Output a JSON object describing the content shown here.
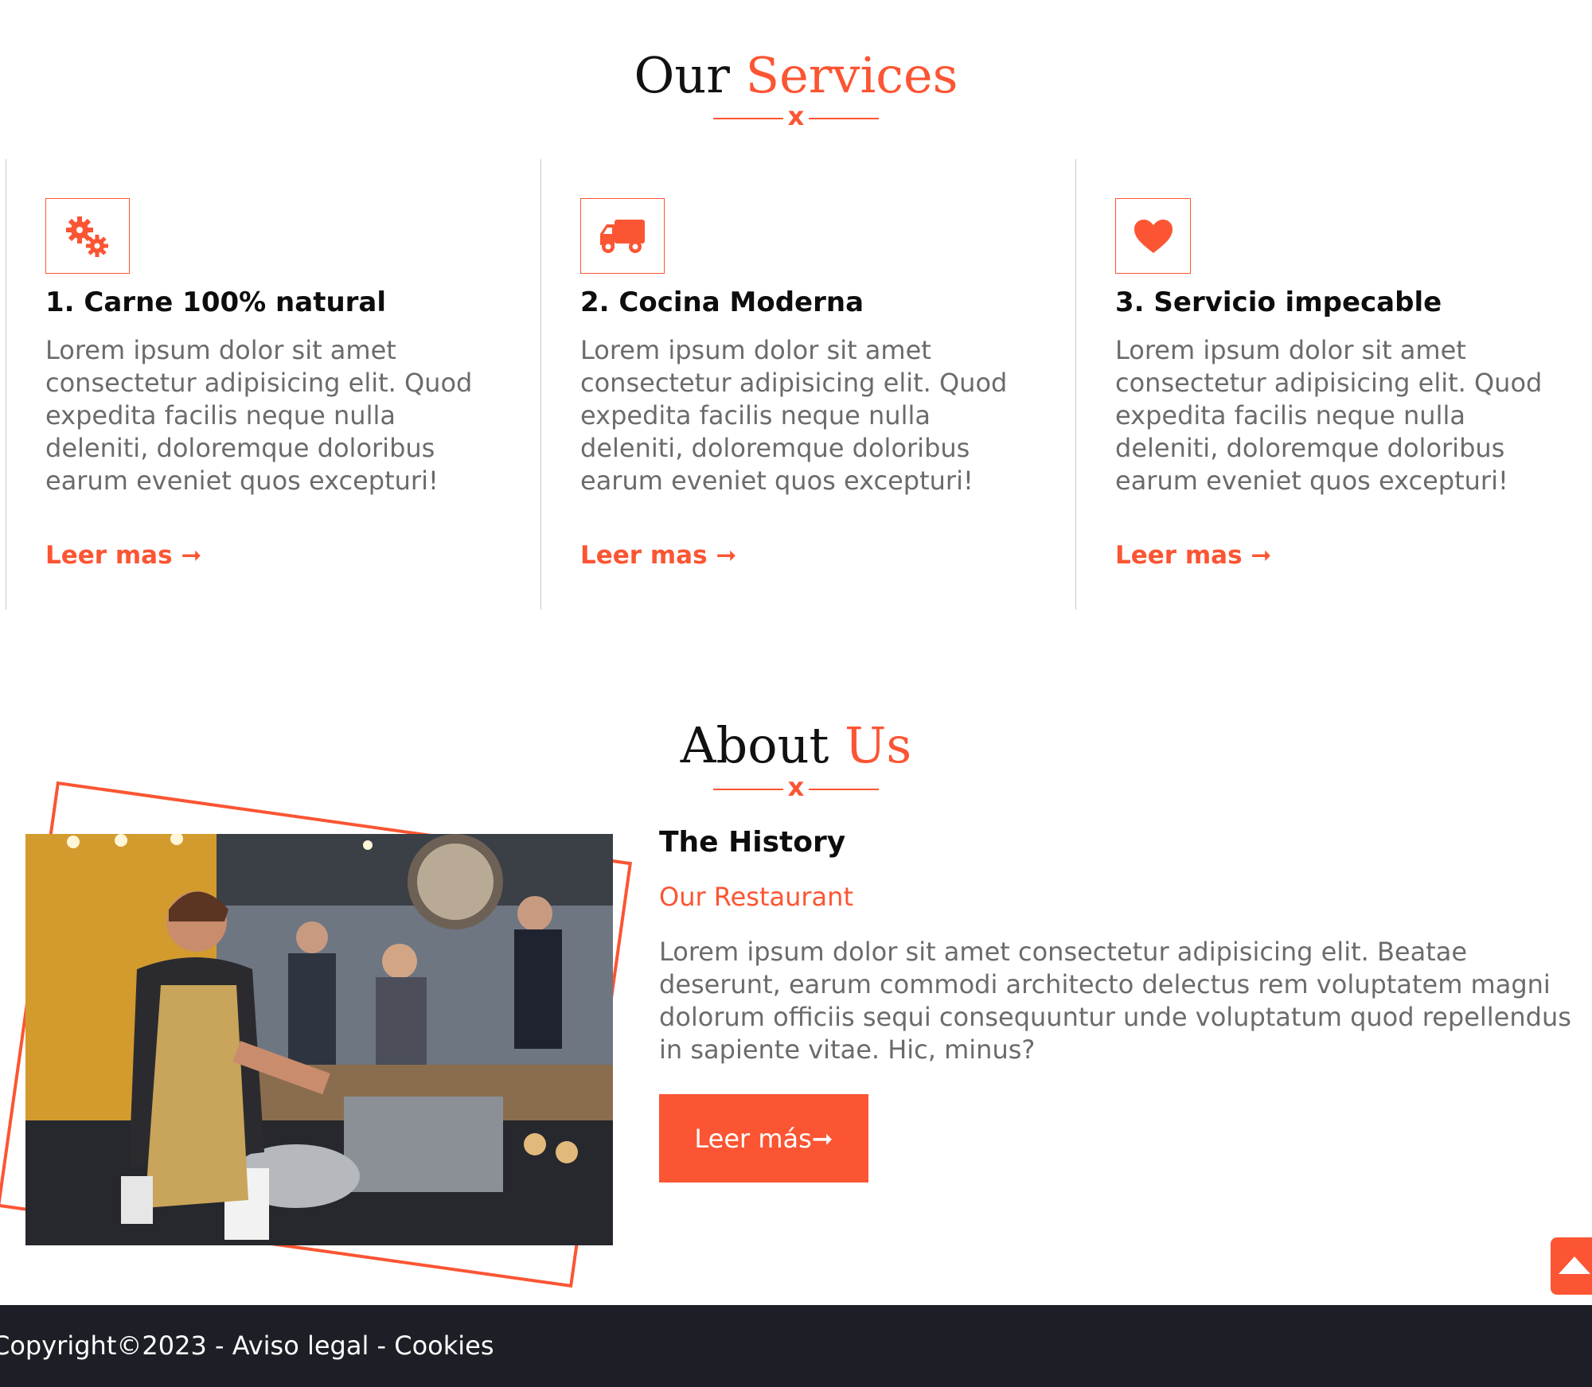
{
  "colors": {
    "accent": "#fb5533",
    "footer_bg": "#1c1f26",
    "text_muted": "#6b6b6b",
    "divider_gray": "#c9c9c9"
  },
  "services_section": {
    "title_part1": "Our",
    "title_part2": "Services",
    "divider_mark": "x",
    "items": [
      {
        "icon": "gears-icon",
        "title": "1. Carne 100% natural",
        "text": "Lorem ipsum dolor sit amet consectetur adipisicing elit. Quod expedita facilis neque nulla deleniti, doloremque doloribus earum eveniet quos excepturi!",
        "link": "Leer mas ➞"
      },
      {
        "icon": "truck-icon",
        "title": "2. Cocina Moderna",
        "text": "Lorem ipsum dolor sit amet consectetur adipisicing elit. Quod expedita facilis neque nulla deleniti, doloremque doloribus earum eveniet quos excepturi!",
        "link": "Leer mas ➞"
      },
      {
        "icon": "heart-icon",
        "title": "3. Servicio impecable",
        "text": "Lorem ipsum dolor sit amet consectetur adipisicing elit. Quod expedita facilis neque nulla deleniti, doloremque doloribus earum eveniet quos excepturi!",
        "link": "Leer mas ➞"
      }
    ]
  },
  "about_section": {
    "title_part1": "About",
    "title_part2": "Us",
    "divider_mark": "x",
    "image_icon": "restaurant-photo",
    "history_title": "The History",
    "history_subtitle": "Our Restaurant",
    "history_text": "Lorem ipsum dolor sit amet consectetur adipisicing elit. Beatae deserunt, earum commodi architecto delectus rem voluptatem magni dolorum officiis sequi consequuntur unde voluptatum quod repellendus in sapiente vitae. Hic, minus?",
    "button_label": "Leer más➞"
  },
  "scroll_top": {
    "icon": "caret-up-icon"
  },
  "footer": {
    "text": "Copyright©2023 - Aviso legal - Cookies"
  }
}
